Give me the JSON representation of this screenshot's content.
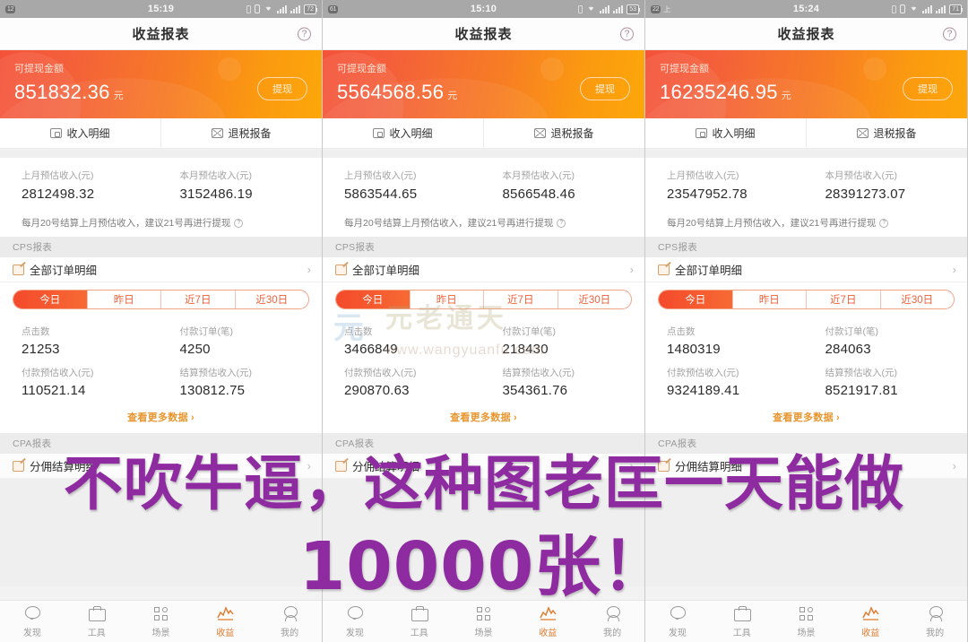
{
  "caption": {
    "line1": "不吹牛逼，这种图老匡一天能做",
    "line2": "10000张！",
    "color": "#8e2ba0"
  },
  "watermark": {
    "logo": "元",
    "cn": "元老通天",
    "url": "www.wangyuanfu.com"
  },
  "navbar": {
    "title": "收益报表",
    "help_icon": "?"
  },
  "banner": {
    "label": "可提现金额",
    "unit": "元",
    "withdraw_label": "提现",
    "gradient_from": "#f4533a",
    "gradient_to": "#fca70a"
  },
  "quicklinks": [
    {
      "label": "收入明细",
      "icon": "wallet-icon"
    },
    {
      "label": "退税报备",
      "icon": "mail-icon"
    }
  ],
  "estimate": {
    "last_month_label": "上月预估收入(元)",
    "this_month_label": "本月预估收入(元)"
  },
  "tip": {
    "text": "每月20号结算上月预估收入，建议21号再进行提现",
    "icon": "?"
  },
  "sections": {
    "cps": "CPS报表",
    "cpa": "CPA报表",
    "all_orders": "全部订单明细",
    "share_detail": "分佣结算明细",
    "arrow": "›"
  },
  "tabs": {
    "items": [
      "今日",
      "昨日",
      "近7日",
      "近30日"
    ],
    "active_index": 0,
    "active_color": "#f4532c"
  },
  "stats_labels": {
    "clicks": "点击数",
    "paid_orders": "付款订单(笔)",
    "paid_income": "付款预估收入(元)",
    "settled_income": "结算预估收入(元)"
  },
  "more_link": {
    "label": "查看更多数据",
    "arrow": "›",
    "color": "#e8962f"
  },
  "tabbar": {
    "items": [
      {
        "label": "发现",
        "icon": "discover-icon",
        "active": false
      },
      {
        "label": "工具",
        "icon": "toolbox-icon",
        "active": false
      },
      {
        "label": "场景",
        "icon": "scene-grid-icon",
        "active": false
      },
      {
        "label": "收益",
        "icon": "income-chart-icon",
        "active": true
      },
      {
        "label": "我的",
        "icon": "profile-icon",
        "active": false
      }
    ],
    "active_color": "#e0792a"
  },
  "panels": [
    {
      "status": {
        "badge": "12",
        "extra": "",
        "time": "15:19",
        "battery": "72"
      },
      "withdrawable": "851832.36",
      "last_month": "2812498.32",
      "this_month": "3152486.19",
      "clicks": "21253",
      "paid_orders": "4250",
      "paid_income": "110521.14",
      "settled_income": "130812.75"
    },
    {
      "status": {
        "badge": "61",
        "extra": "",
        "time": "15:10",
        "battery": "53"
      },
      "withdrawable": "5564568.56",
      "last_month": "5863544.65",
      "this_month": "8566548.46",
      "clicks": "3466849",
      "paid_orders": "218430",
      "paid_income": "290870.63",
      "settled_income": "354361.76"
    },
    {
      "status": {
        "badge": "22",
        "extra": "上",
        "time": "15:24",
        "battery": "71"
      },
      "withdrawable": "16235246.95",
      "last_month": "23547952.78",
      "this_month": "28391273.07",
      "clicks": "1480319",
      "paid_orders": "284063",
      "paid_income": "9324189.41",
      "settled_income": "8521917.81"
    }
  ]
}
